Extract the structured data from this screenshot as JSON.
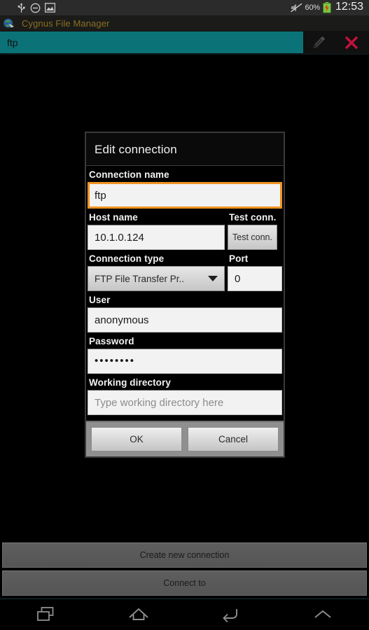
{
  "status_bar": {
    "icons": [
      "usb-icon",
      "do-not-disturb-icon",
      "screenshot-image-icon"
    ],
    "mute_icon": "volume-muted-icon",
    "battery_percent": "60%",
    "battery_icon": "battery-charging-icon",
    "clock": "12:53"
  },
  "app_bar": {
    "icon": "cygnus-globe-icon",
    "title": "Cygnus File Manager",
    "title_color": "#8a7022"
  },
  "path_bar": {
    "value": "ftp",
    "placeholder": "",
    "background_color": "#0b7377",
    "edit_icon": "pencil-edit-icon",
    "close_icon": "close-x-icon",
    "close_color": "#c5103f"
  },
  "dialog": {
    "title": "Edit connection",
    "fields": {
      "connection_name": {
        "label": "Connection name",
        "value": "ftp",
        "focused": true,
        "focus_color": "#f09323"
      },
      "host_name": {
        "label": "Host name",
        "value": "10.1.0.124"
      },
      "test_conn": {
        "label": "Test conn.",
        "button_label": "Test conn."
      },
      "connection_type": {
        "label": "Connection type",
        "selected": "FTP File Transfer Pr..",
        "icon": "chevron-down-icon"
      },
      "port": {
        "label": "Port",
        "value": "0"
      },
      "user": {
        "label": "User",
        "value": "anonymous"
      },
      "password": {
        "label": "Password",
        "value": "••••••••"
      },
      "working_directory": {
        "label": "Working directory",
        "value": "",
        "placeholder": "Type working directory here"
      }
    },
    "buttons": {
      "ok": "OK",
      "cancel": "Cancel"
    }
  },
  "bottom_actions": [
    {
      "label": "Create new connection",
      "name": "create-new-connection-button"
    },
    {
      "label": "Connect to",
      "name": "connect-to-button"
    }
  ],
  "nav_bar": {
    "recents": "recents-icon",
    "home": "home-icon",
    "back": "back-icon",
    "chevron_up": "chevron-up-icon"
  }
}
